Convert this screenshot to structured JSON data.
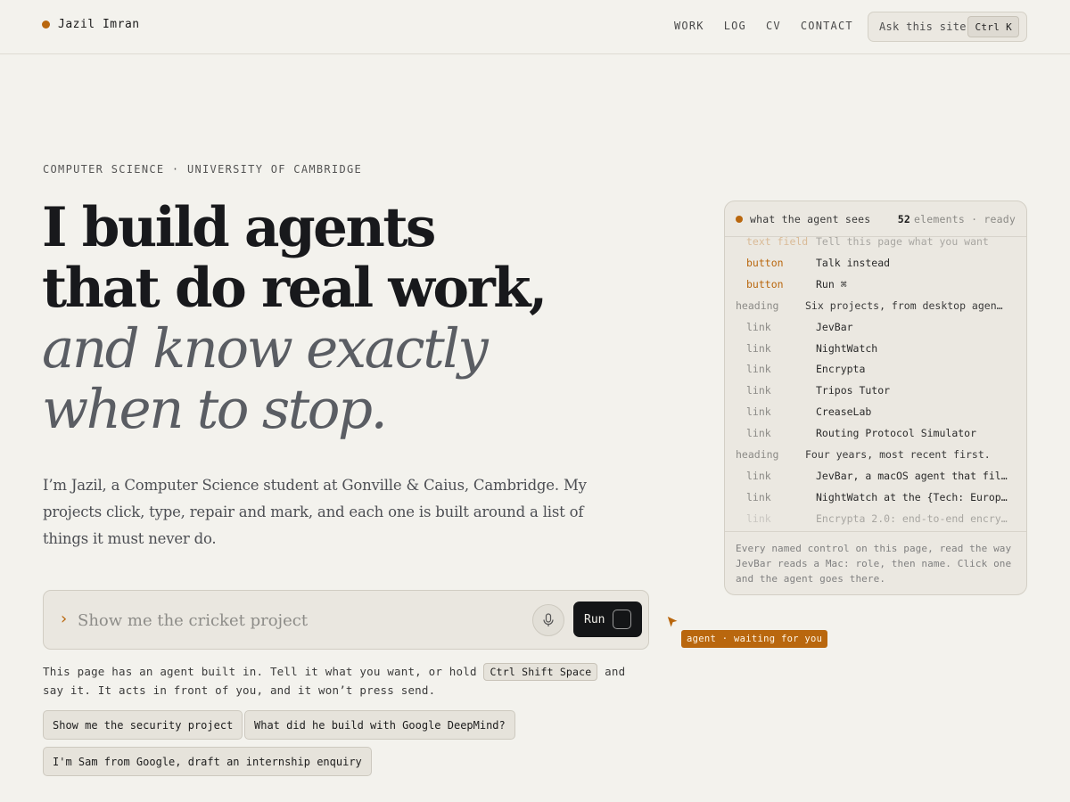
{
  "header": {
    "brand": "Jazil Imran",
    "nav": [
      "WORK",
      "LOG",
      "CV",
      "CONTACT"
    ],
    "ask_label": "Ask this site",
    "ask_shortcut": "Ctrl K"
  },
  "hero": {
    "eyebrow": "COMPUTER SCIENCE · UNIVERSITY OF CAMBRIDGE",
    "title_lines": [
      "I build agents",
      "that do real work,"
    ],
    "title_italic_lines": [
      "and know exactly",
      "when to stop."
    ],
    "intro": "I’m Jazil, a Computer Science student at Gonville & Caius, Cambridge. My projects click, type, repair and mark, and each one is built around a list of things it must never do."
  },
  "command": {
    "placeholder": "Show me the cricket project",
    "run_label": "Run",
    "helper_before": "This page has an agent built in. Tell it what you want, or hold",
    "helper_shortcut": "Ctrl Shift Space",
    "helper_after": "and say it. It acts in front of you, and it won’t press send."
  },
  "suggestions": [
    "Show me the security project",
    "What did he build with Google DeepMind?",
    "I'm Sam from Google, draft an internship enquiry"
  ],
  "agent_panel": {
    "title": "what the agent sees",
    "count": "52",
    "count_suffix": "elements · ready",
    "rows": [
      {
        "role": "text field",
        "name": "Tell this page what you want",
        "kind": "field"
      },
      {
        "role": "button",
        "name": "Talk instead",
        "kind": "button"
      },
      {
        "role": "button",
        "name": "Run ⌘",
        "kind": "button"
      },
      {
        "role": "heading",
        "name": "Six projects, from desktop agen…",
        "kind": "heading"
      },
      {
        "role": "link",
        "name": "JevBar",
        "kind": "link"
      },
      {
        "role": "link",
        "name": "NightWatch",
        "kind": "link"
      },
      {
        "role": "link",
        "name": "Encrypta",
        "kind": "link"
      },
      {
        "role": "link",
        "name": "Tripos Tutor",
        "kind": "link"
      },
      {
        "role": "link",
        "name": "CreaseLab",
        "kind": "link"
      },
      {
        "role": "link",
        "name": "Routing Protocol Simulator",
        "kind": "link"
      },
      {
        "role": "heading",
        "name": "Four years, most recent first.",
        "kind": "heading"
      },
      {
        "role": "link",
        "name": "JevBar, a macOS agent that fil…",
        "kind": "link"
      },
      {
        "role": "link",
        "name": "NightWatch at the {Tech: Europ…",
        "kind": "link"
      },
      {
        "role": "link",
        "name": "Encrypta 2.0: end-to-end encry…",
        "kind": "link"
      }
    ],
    "footer": "Every named control on this page, read the way JevBar reads a Mac: role, then name. Click one and the agent goes there."
  },
  "cursor_tag": "agent · waiting for you",
  "colors": {
    "accent": "#b9670e",
    "background": "#f3f2ed",
    "ink": "#18191c"
  }
}
